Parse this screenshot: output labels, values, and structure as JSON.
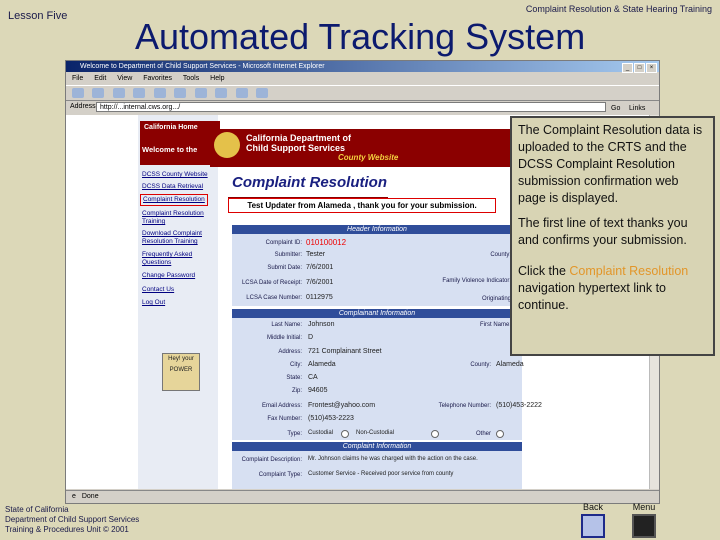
{
  "slide": {
    "lesson": "Lesson Five",
    "header_right": "Complaint Resolution & State Hearing Training",
    "title": "Automated Tracking System",
    "footer_lines": [
      "State of California",
      "Department of Child Support Services",
      "Training & Procedures Unit © 2001"
    ],
    "nav": {
      "back": "Back",
      "menu": "Menu"
    }
  },
  "browser": {
    "window_title": "Welcome to Department of Child Support Services - Microsoft Internet Explorer",
    "menu": [
      "File",
      "Edit",
      "View",
      "Favorites",
      "Tools",
      "Help"
    ],
    "address_label": "Address",
    "address_value": "http://...internal.cws.org.../",
    "go_label": "Go",
    "links_label": "Links",
    "status_text": "Done"
  },
  "page": {
    "california_home": "California Home",
    "welcome": "Welcome to the",
    "banner_title_1": "California Department of",
    "banner_title_2": "Child Support Services",
    "banner_county": "County Website",
    "nav_links": [
      "DCSS County Website",
      "DCSS Data Retrieval",
      "Complaint Resolution",
      "Complaint Resolution Training",
      "Download Complaint Resolution Training",
      "Frequently Asked Questions",
      "Change Password",
      "Contact Us",
      "Log Out"
    ],
    "poster_text": "Hey! your POWER",
    "logo_text": "Complaint Resolution",
    "message": "Test Updater from Alameda , thank you for your submission.",
    "header_section": "Header Information",
    "complainant_section": "Complainant Information",
    "complaint_section": "Complaint Information",
    "header_fields": [
      {
        "label": "Complaint ID:",
        "value": "010100012"
      },
      {
        "label": "Submitter:",
        "value": "Tester"
      },
      {
        "label": "Submit Date:",
        "value": "7/6/2001"
      },
      {
        "label": "LCSA Date of Receipt:",
        "value": "7/6/2001"
      },
      {
        "label": "LCSA Case Number:",
        "value": "0112975"
      }
    ],
    "header_right_labels": [
      "County:",
      "Family Violence Indicator:",
      "Originating"
    ],
    "complainant_fields": [
      {
        "label": "Last Name:",
        "value": "Johnson"
      },
      {
        "label": "Middle Initial:",
        "value": "D"
      },
      {
        "label": "Address:",
        "value": "721 Complainant Street"
      },
      {
        "label": "City:",
        "value": "Alameda"
      },
      {
        "label": "State:",
        "value": "CA"
      },
      {
        "label": "Zip:",
        "value": "94605"
      },
      {
        "label": "Email Address:",
        "value": "Frontest@yahoo.com"
      },
      {
        "label": "Fax Number:",
        "value": "(510)453-2223"
      },
      {
        "label": "Type:",
        "value": "Custodial"
      }
    ],
    "complainant_right": [
      {
        "label": "First Name:",
        "value": ""
      },
      {
        "label": "County:",
        "value": "Alameda"
      },
      {
        "label": "Telephone Number:",
        "value": "(510)453-2222"
      },
      {
        "label": "Other",
        "value": ""
      }
    ],
    "type_options": [
      "Custodial",
      "Non-Custodial",
      "Other"
    ],
    "complaint_fields": [
      {
        "label": "Complaint Description:",
        "value": "Mr. Johnson claims he was charged with the action on the case."
      },
      {
        "label": "Complaint Type:",
        "value": "Customer Service - Received poor service from county"
      }
    ]
  },
  "callout": {
    "p1": "The Complaint Resolution data is uploaded to the CRTS and the DCSS Complaint Resolution submission confirmation web page is displayed.",
    "p2": "The first line of text thanks you and confirms your submission.",
    "p3_prefix": "Click the ",
    "p3_link": "Complaint Resolution",
    "p3_suffix": " navigation hypertext link to continue."
  },
  "colors": {
    "title": "#0c1a6e",
    "callout_link": "#e2962a",
    "maroon": "#8b0000",
    "form_blue": "#2f4d9a"
  }
}
